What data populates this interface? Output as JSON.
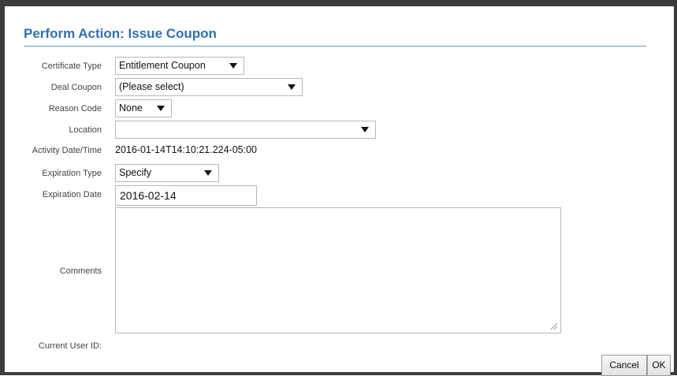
{
  "dialog": {
    "title": "Perform Action: Issue Coupon"
  },
  "form": {
    "certificate_type": {
      "label": "Certificate Type",
      "value": "Entitlement Coupon"
    },
    "deal_coupon": {
      "label": "Deal Coupon",
      "value": "(Please select)"
    },
    "reason_code": {
      "label": "Reason Code",
      "value": "None"
    },
    "location": {
      "label": "Location",
      "value": ""
    },
    "activity_datetime": {
      "label": "Activity Date/Time",
      "value": "2016-01-14T14:10:21.224-05:00"
    },
    "expiration_type": {
      "label": "Expiration Type",
      "value": "Specify"
    },
    "expiration_date": {
      "label": "Expiration Date",
      "value": "2016-02-14"
    },
    "comments": {
      "label": "Comments",
      "value": ""
    },
    "current_user_id": {
      "label": "Current User ID:",
      "value": ""
    }
  },
  "buttons": {
    "cancel": "Cancel",
    "ok": "OK"
  },
  "colors": {
    "title": "#2f6fb0",
    "title_rule": "#5b9bd5",
    "frame": "#3c3c3c"
  },
  "icons": {
    "dropdown": "triangle-down",
    "resize": "resize-grip"
  }
}
